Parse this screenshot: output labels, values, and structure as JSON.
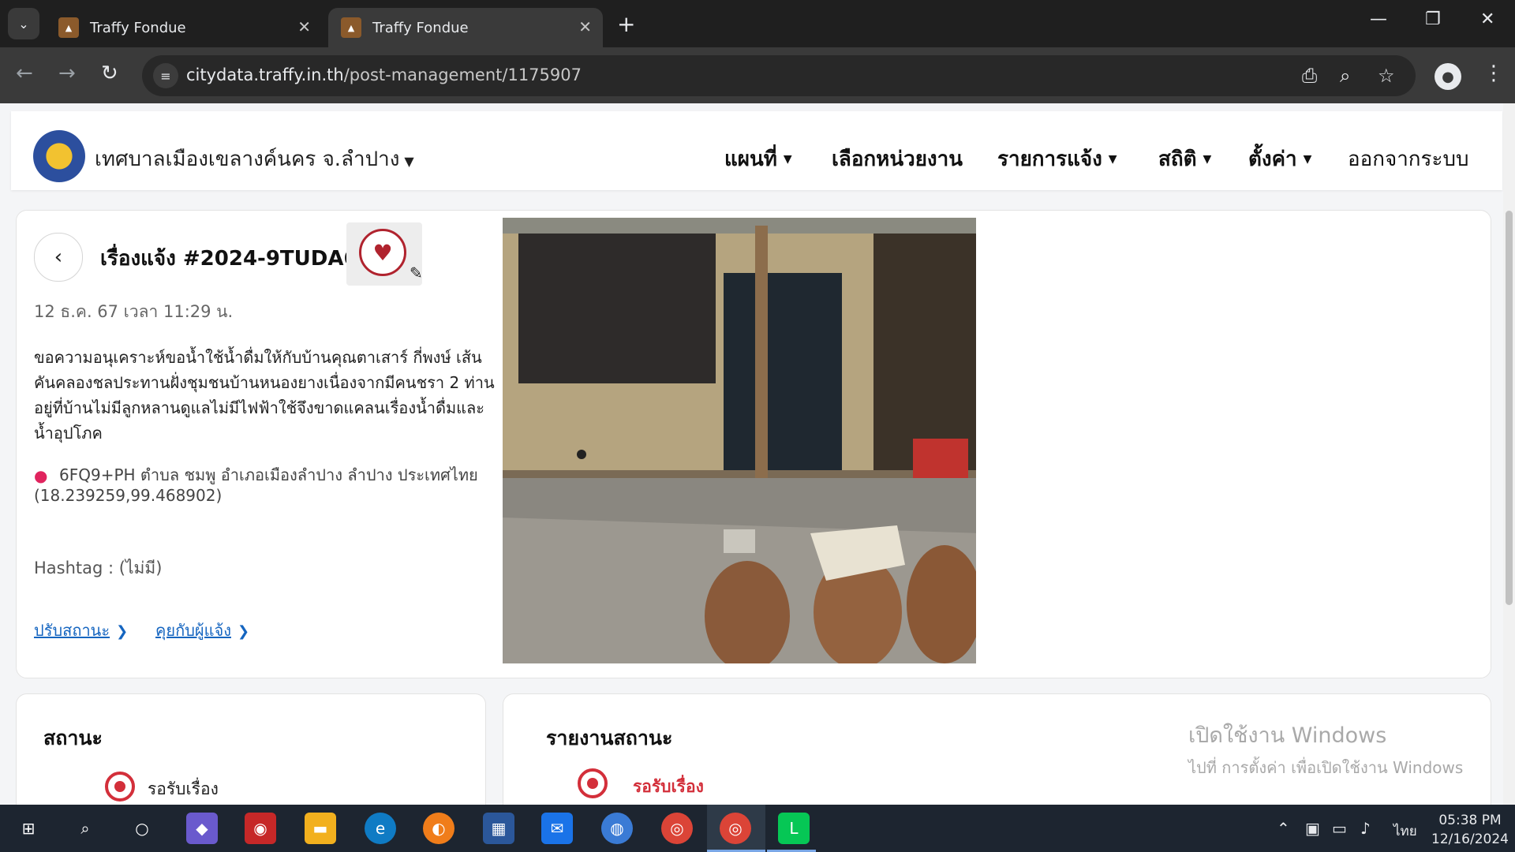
{
  "browser": {
    "tabs": [
      {
        "title": "Traffy Fondue",
        "active": false
      },
      {
        "title": "Traffy Fondue",
        "active": true
      }
    ],
    "url_host": "citydata.traffy.in.th",
    "url_path": "/post-management/1175907",
    "icons": {
      "tab_menu": "chevron-down-icon",
      "favicon": "traffy-fondue-icon",
      "close": "close-icon",
      "new_tab": "plus-icon",
      "back": "arrow-left-icon",
      "forward": "arrow-right-icon",
      "reload": "reload-icon",
      "site_info": "tune-icon",
      "install": "install-app-icon",
      "zoom": "zoom-icon",
      "bookmark": "star-icon",
      "profile": "person-icon",
      "menu": "kebab-icon"
    }
  },
  "site_nav": {
    "org_name": "เทศบาลเมืองเขลางค์นคร จ.ลำปาง",
    "menu": [
      {
        "label": "แผนที่",
        "dropdown": true
      },
      {
        "label": "เลือกหน่วยงาน",
        "dropdown": false
      },
      {
        "label": "รายการแจ้ง",
        "dropdown": true
      },
      {
        "label": "สถิติ",
        "dropdown": true
      },
      {
        "label": "ตั้งค่า",
        "dropdown": true
      },
      {
        "label": "ออกจากระบบ",
        "dropdown": false
      }
    ]
  },
  "report": {
    "title": "เรื่องแจ้ง #2024-9TUDA6",
    "category_icon": "heart-hand-icon",
    "datetime": "12 ธ.ค. 67 เวลา 11:29 น.",
    "description": "ขอความอนุเคราะห์ขอน้ำใช้น้ำดื่มให้กับบ้านคุณตาเสาร์  กี่พงษ์ เส้นคันคลองชลประทานฝั่งชุมชนบ้านหนองยางเนื่องจากมีคนชรา 2 ท่านอยู่ที่บ้านไม่มีลูกหลานดูแลไม่มีไฟฟ้าใช้จึงขาดแคลนเรื่องน้ำดื่มและน้ำอุปโภค",
    "location": "6FQ9+PH ตำบล ชมพู อำเภอเมืองลำปาง ลำปาง ประเทศไทย (18.239259,99.468902)",
    "hashtag_label": "Hashtag :",
    "hashtag_value": "(ไม่มี)",
    "actions": [
      {
        "label": "ปรับสถานะ"
      },
      {
        "label": "คุยกับผู้แจ้ง"
      }
    ]
  },
  "status_card": {
    "heading": "สถานะ",
    "item": "รอรับเรื่อง"
  },
  "status_report_card": {
    "heading": "รายงานสถานะ",
    "item": "รอรับเรื่อง"
  },
  "watermark": {
    "title": "เปิดใช้งาน Windows",
    "subtitle": "ไปที่ การตั้งค่า เพื่อเปิดใช้งาน Windows"
  },
  "taskbar": {
    "language": "ไทย",
    "time": "05:38 PM",
    "date": "12/16/2024",
    "apps": [
      "windows-start-icon",
      "search-icon",
      "task-view-icon",
      "copilot-icon",
      "camera-app-icon",
      "file-explorer-icon",
      "edge-icon",
      "vpn-app-icon",
      "microsoft-store-icon",
      "mail-icon",
      "network-globe-icon",
      "chrome-icon",
      "chrome-active-icon",
      "line-icon"
    ]
  },
  "colors": {
    "accent_red": "#d32f3a",
    "link_blue": "#1565c0",
    "chrome_dark": "#1f1f1f"
  }
}
